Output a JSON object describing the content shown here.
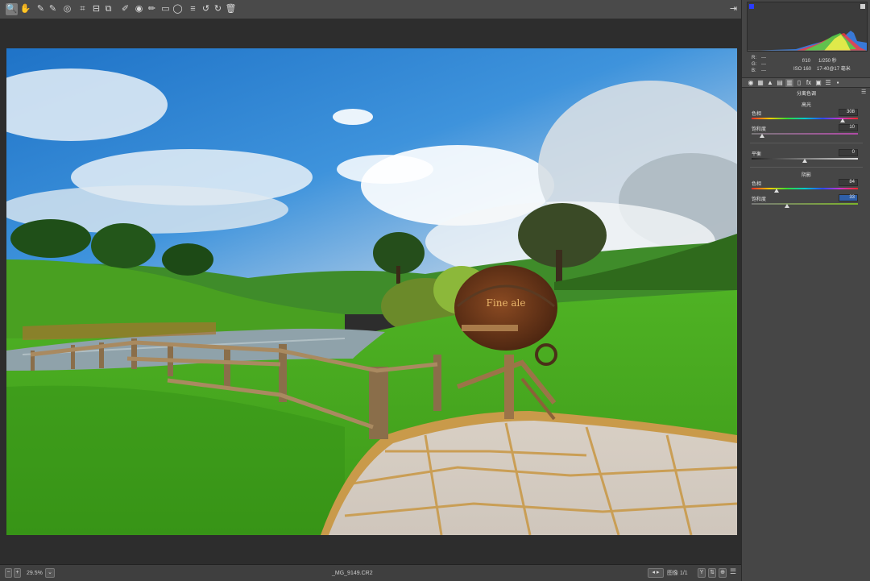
{
  "toolbar": {
    "tools": [
      "zoom-tool",
      "hand-tool",
      "white-balance-tool",
      "color-sampler-tool",
      "targeted-adjustment-tool",
      "crop-tool",
      "straighten-tool",
      "transform-tool",
      "spot-removal-tool",
      "red-eye-tool",
      "adjustment-brush-tool",
      "graduated-filter-tool",
      "radial-filter-tool",
      "preferences",
      "rotate-left",
      "rotate-right",
      "trash"
    ],
    "glyphs": [
      "🔍",
      "✋",
      "✎",
      "✎",
      "◎",
      "⌗",
      "⊟",
      "⧉",
      "✐",
      "◉",
      "✏",
      "▭",
      "◯",
      "≡",
      "↺",
      "↻",
      "🗑"
    ]
  },
  "info": {
    "r_label": "R:",
    "g_label": "G:",
    "b_label": "B:",
    "r_val": "---",
    "g_val": "---",
    "b_val": "---",
    "aperture": "f/10",
    "shutter": "1/250 秒",
    "iso": "ISO 160",
    "lens": "17-40@17 毫米"
  },
  "panel": {
    "section_title": "分离色调",
    "highlights_title": "高光",
    "hue_label": "色相",
    "saturation_label": "饱和度",
    "balance_label": "平衡",
    "shadows_title": "阴影",
    "hl_hue": "308",
    "hl_sat": "10",
    "balance": "0",
    "sh_hue": "84",
    "sh_sat": "33"
  },
  "slider_levels": {
    "hl_hue": 0.856,
    "hl_sat": 0.1,
    "balance": 0.5,
    "sh_hue": 0.233,
    "sh_sat": 0.33
  },
  "status": {
    "zoom": "29.5%",
    "filename": "_MG_9149.CR2",
    "image_count": "图像 1/1"
  },
  "colors": {
    "accent": "#2f5fa8",
    "panel_bg": "#464646",
    "canvas_bg": "#2d2d2d"
  }
}
